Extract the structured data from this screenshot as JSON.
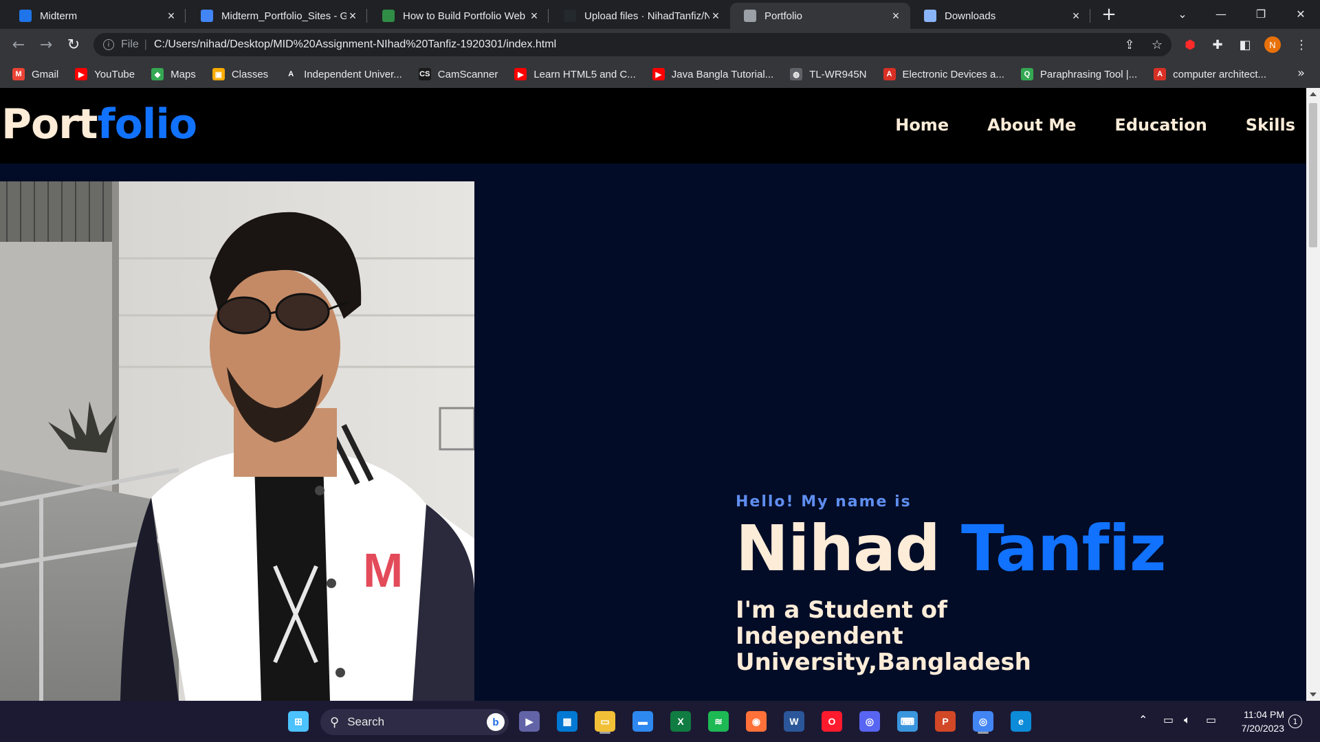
{
  "tabs": [
    {
      "title": "Midterm",
      "icon": "classroom-icon",
      "color": "#1e74e8"
    },
    {
      "title": "Midterm_Portfolio_Sites - G",
      "icon": "docs-icon",
      "color": "#4285f4"
    },
    {
      "title": "How to Build Portfolio Web",
      "icon": "gfg-icon",
      "color": "#2f8d46"
    },
    {
      "title": "Upload files · NihadTanfiz/N",
      "icon": "github-icon",
      "color": "#24292e"
    },
    {
      "title": "Portfolio",
      "icon": "globe-icon",
      "color": "#9aa0a6",
      "active": true
    },
    {
      "title": "Downloads",
      "icon": "download-icon",
      "color": "#8ab4f8"
    }
  ],
  "address": {
    "scheme": "File",
    "url": "C:/Users/nihad/Desktop/MID%20Assignment-NIhad%20Tanfiz-1920301/index.html"
  },
  "profile_initial": "N",
  "bookmarks": [
    {
      "label": "Gmail",
      "icon": "gmail-icon",
      "color": "#ea4335",
      "glyph": "M"
    },
    {
      "label": "YouTube",
      "icon": "youtube-icon",
      "color": "#ff0000",
      "glyph": "▶"
    },
    {
      "label": "Maps",
      "icon": "maps-icon",
      "color": "#34a853",
      "glyph": "◆"
    },
    {
      "label": "Classes",
      "icon": "classroom-icon",
      "color": "#f9ab00",
      "glyph": "▣"
    },
    {
      "label": "Independent Univer...",
      "icon": "iub-icon",
      "color": "#35363a",
      "glyph": "A"
    },
    {
      "label": "CamScanner",
      "icon": "camscanner-icon",
      "color": "#1a1a1a",
      "glyph": "CS"
    },
    {
      "label": "Learn HTML5 and C...",
      "icon": "youtube-icon",
      "color": "#ff0000",
      "glyph": "▶"
    },
    {
      "label": "Java Bangla Tutorial...",
      "icon": "youtube-icon",
      "color": "#ff0000",
      "glyph": "▶"
    },
    {
      "label": "TL-WR945N",
      "icon": "globe-icon",
      "color": "#5f6368",
      "glyph": "◍"
    },
    {
      "label": "Electronic Devices a...",
      "icon": "pdf-icon",
      "color": "#d93025",
      "glyph": "A"
    },
    {
      "label": "Paraphrasing Tool |...",
      "icon": "quillbot-icon",
      "color": "#34a853",
      "glyph": "Q"
    },
    {
      "label": "computer architect...",
      "icon": "pdf-icon",
      "color": "#d93025",
      "glyph": "A"
    }
  ],
  "site": {
    "logo_part1": "Port",
    "logo_part2": "folio",
    "nav": [
      "Home",
      "About Me",
      "Education",
      "Skills"
    ],
    "hello": "Hello! My name is",
    "first_name": "Nihad",
    "last_name": "Tanfiz",
    "tagline": "I'm a Student of Independent University,Bangladesh",
    "colors": {
      "accent": "#1172ff",
      "cream": "#fdecd8",
      "hero_bg": "#020c27",
      "hello": "#5f8ef0"
    }
  },
  "taskbar": {
    "search_label": "Search",
    "apps": [
      {
        "name": "start-icon",
        "color": "#4cc2ff",
        "glyph": "⊞"
      },
      {
        "name": "teams-icon",
        "color": "#6264a7",
        "glyph": "▶"
      },
      {
        "name": "store-icon",
        "color": "#0078d4",
        "glyph": "▦"
      },
      {
        "name": "file-explorer-icon",
        "color": "#f2c037",
        "glyph": "▭"
      },
      {
        "name": "desktop-icon",
        "color": "#2d89ef",
        "glyph": "▬"
      },
      {
        "name": "excel-icon",
        "color": "#107c41",
        "glyph": "X"
      },
      {
        "name": "spotify-icon",
        "color": "#1db954",
        "glyph": "≋"
      },
      {
        "name": "firefox-icon",
        "color": "#ff7139",
        "glyph": "◉"
      },
      {
        "name": "word-icon",
        "color": "#2b579a",
        "glyph": "W"
      },
      {
        "name": "opera-icon",
        "color": "#ff1b2d",
        "glyph": "O"
      },
      {
        "name": "discord-icon",
        "color": "#5865f2",
        "glyph": "◎"
      },
      {
        "name": "keyboard-app-icon",
        "color": "#3a96dd",
        "glyph": "⌨"
      },
      {
        "name": "powerpoint-icon",
        "color": "#d24726",
        "glyph": "P"
      },
      {
        "name": "chrome-icon",
        "color": "#4285f4",
        "glyph": "◎"
      },
      {
        "name": "edge-icon",
        "color": "#0c8bd8",
        "glyph": "e"
      }
    ],
    "time": "11:04 PM",
    "date": "7/20/2023",
    "notifications": "1"
  }
}
